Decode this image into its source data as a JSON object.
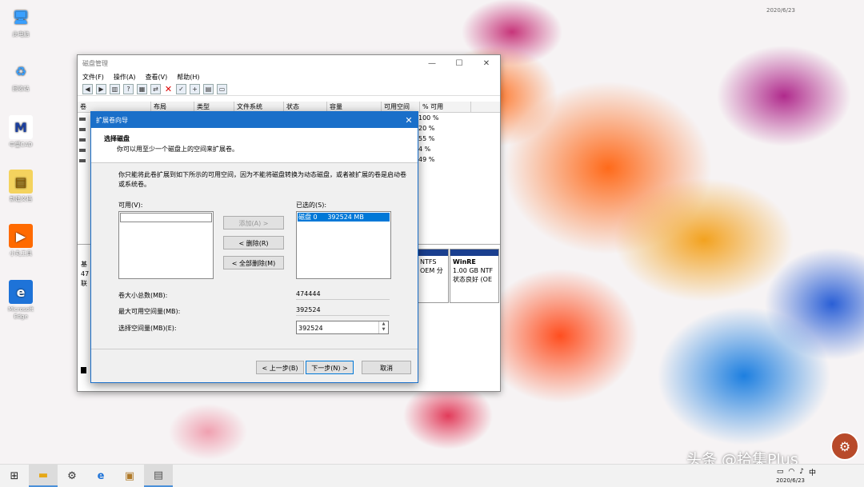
{
  "desktop": {
    "date_corner": "2020/6/23",
    "icons": [
      {
        "label": "此电脑",
        "icon": "computer-icon"
      },
      {
        "label": "回收站",
        "icon": "recycle-bin-icon"
      },
      {
        "label": "中望CAD",
        "icon": "cad-icon"
      },
      {
        "label": "新建文档",
        "icon": "document-icon"
      },
      {
        "label": "小丸工具",
        "icon": "media-tool-icon"
      },
      {
        "label": "Microsoft Edge",
        "icon": "edge-icon"
      }
    ]
  },
  "disk_mgmt": {
    "title": "磁盘管理",
    "controls": {
      "minimize": "—",
      "maximize": "☐",
      "close": "✕"
    },
    "menu": [
      "文件(F)",
      "操作(A)",
      "查看(V)",
      "帮助(H)"
    ],
    "columns": [
      "卷",
      "布局",
      "类型",
      "文件系统",
      "状态",
      "容量",
      "可用空间",
      "% 可用"
    ],
    "percent_free": [
      "100 %",
      "20 %",
      "55 %",
      "4 %",
      "49 %"
    ],
    "disk_info": {
      "line1": "基",
      "line2": "47",
      "line3": "联"
    },
    "partitions": [
      {
        "name": "",
        "line1": "NTFS",
        "line2": "OEM 分"
      },
      {
        "name": "WinRE",
        "line1": "1.00 GB NTF",
        "line2": "状态良好 (OE"
      }
    ]
  },
  "wizard": {
    "title": "扩展卷向导",
    "close": "✕",
    "heading": "选择磁盘",
    "subheading": "你可以用至少一个磁盘上的空间来扩展卷。",
    "description": "你只能将此卷扩展到如下所示的可用空间，因为不能将磁盘转换为动态磁盘，或者被扩展的卷是启动卷或系统卷。",
    "available_label": "可用(V):",
    "selected_label": "已选的(S):",
    "selected_items": [
      "磁盘 0     392524 MB"
    ],
    "add_button": "添加(A) >",
    "remove_button": "< 删除(R)",
    "remove_all_button": "< 全部删除(M)",
    "total_size_label": "卷大小总数(MB):",
    "total_size_value": "474444",
    "max_space_label": "最大可用空间量(MB):",
    "max_space_value": "392524",
    "select_space_label": "选择空间量(MB)(E):",
    "select_space_value": "392524",
    "back_button": "< 上一步(B)",
    "next_button": "下一步(N) >",
    "cancel_button": "取消"
  },
  "taskbar": {
    "items": [
      "windows-start-icon",
      "file-explorer-icon",
      "settings-icon",
      "edge-icon",
      "store-icon",
      "disk-mgmt-icon"
    ],
    "tray_text": "中",
    "date": "2020/6/23"
  },
  "watermark": "头条 @拾集Plus"
}
